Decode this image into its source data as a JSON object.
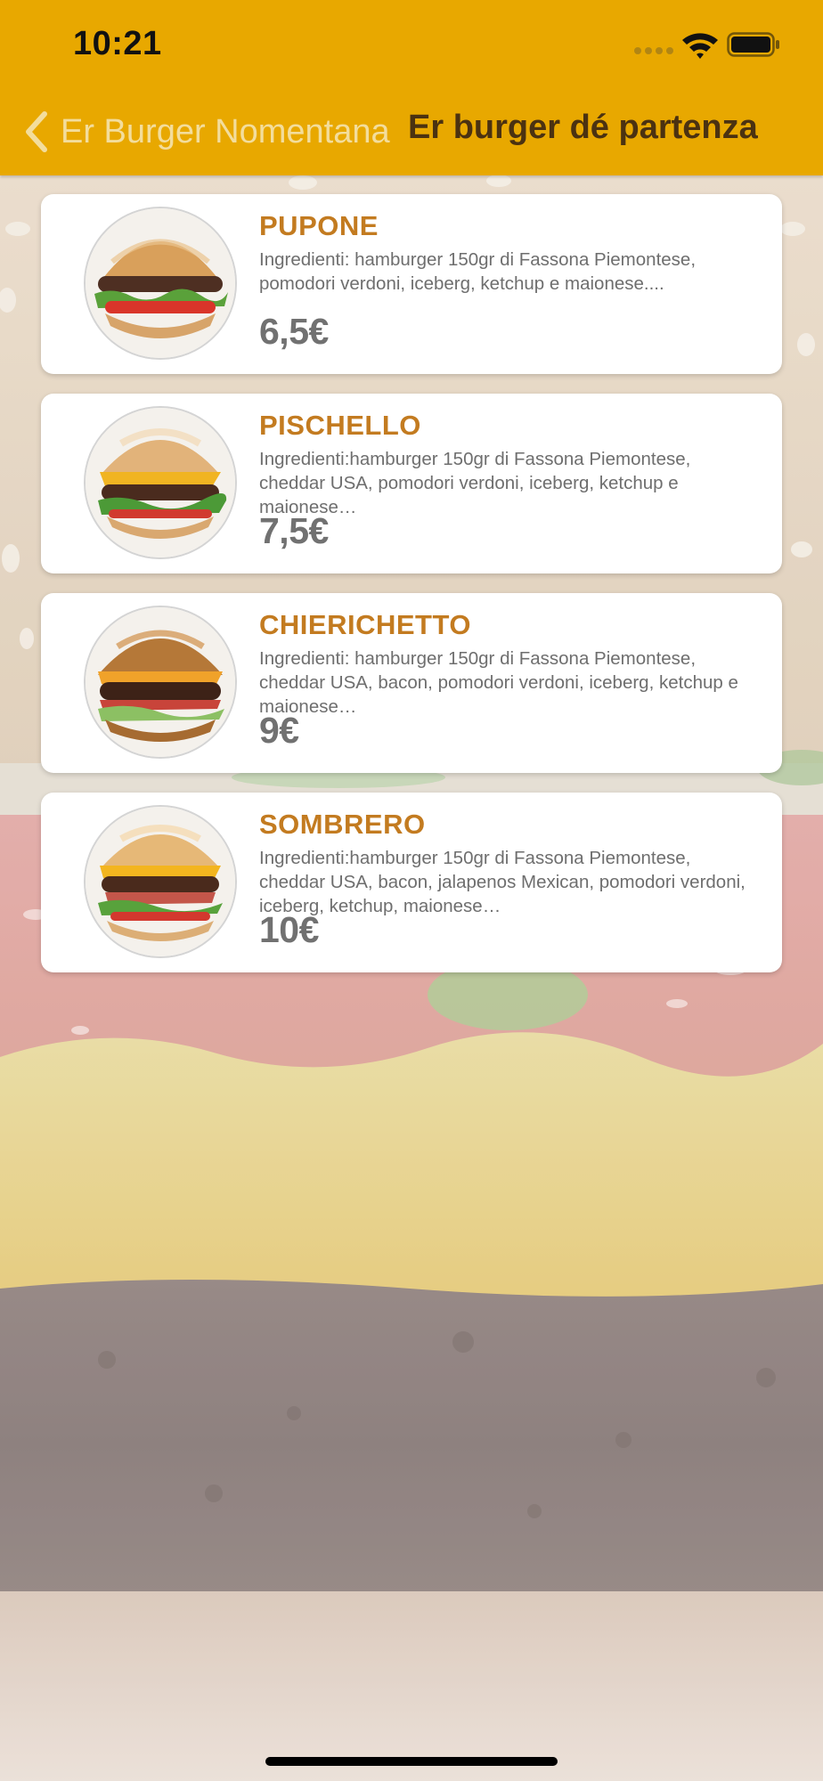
{
  "status_bar": {
    "time": "10:21"
  },
  "nav": {
    "back_label": "Er Burger Nomentana",
    "title": "Er burger dé partenza"
  },
  "colors": {
    "header_bg": "#e8a800",
    "item_name": "#c37b20",
    "price": "#717171"
  },
  "menu": [
    {
      "name": "PUPONE",
      "description": "Ingredienti: hamburger 150gr di Fassona Piemontese, pomodori verdoni, iceberg, ketchup e maionese....",
      "price": "6,5€",
      "image": "burger-photo"
    },
    {
      "name": "PISCHELLO",
      "description": "Ingredienti:hamburger 150gr di Fassona Piemontese, cheddar USA, pomodori verdoni, iceberg, ketchup e maionese…",
      "price": "7,5€",
      "image": "cheeseburger-photo"
    },
    {
      "name": "CHIERICHETTO",
      "description": "Ingredienti: hamburger 150gr di Fassona Piemontese, cheddar USA, bacon, pomodori verdoni, iceberg, ketchup e maionese…",
      "price": "9€",
      "image": "bacon-cheeseburger-photo"
    },
    {
      "name": "SOMBRERO",
      "description": "Ingredienti:hamburger 150gr di Fassona Piemontese, cheddar USA, bacon, jalapenos Mexican, pomodori verdoni, iceberg, ketchup, maionese…",
      "price": "10€",
      "image": "jalapeno-burger-photo"
    }
  ]
}
